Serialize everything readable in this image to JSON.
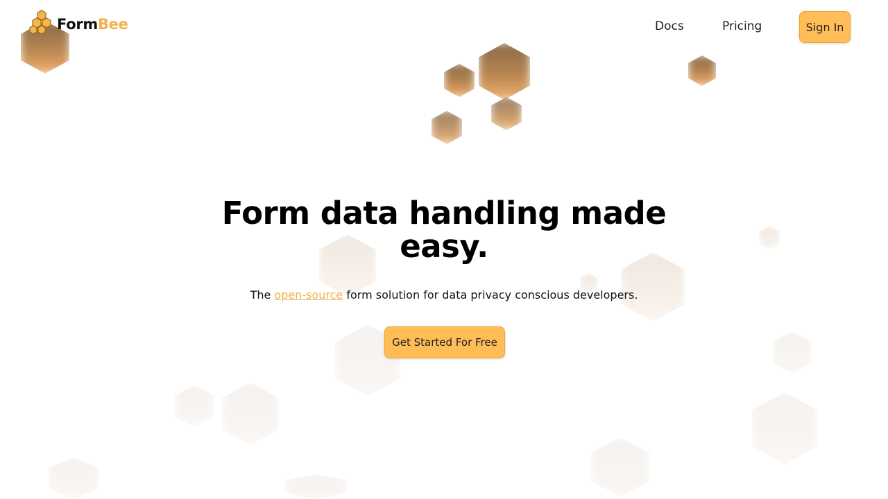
{
  "brand": {
    "name_part1": "Form",
    "name_part2": "Bee",
    "accent_color": "#f2b150",
    "logo_icon": "honeycomb-icon"
  },
  "nav": {
    "docs_label": "Docs",
    "pricing_label": "Pricing",
    "signin_label": "Sign In"
  },
  "hero": {
    "title_line1": "Form data handling made",
    "title_line2": "easy.",
    "subtitle_prefix": "The ",
    "subtitle_link": "open-source",
    "subtitle_suffix": " form solution for data privacy conscious developers.",
    "cta_label": "Get Started For Free"
  },
  "colors": {
    "button_bg": "#ffbd57",
    "background": "#ffffff"
  }
}
